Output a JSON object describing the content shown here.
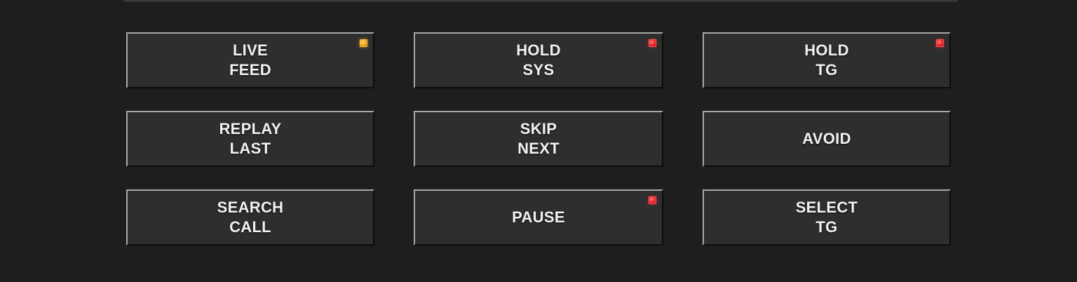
{
  "buttons": [
    {
      "id": "live-feed",
      "lines": [
        "LIVE",
        "FEED"
      ],
      "indicator": "amber"
    },
    {
      "id": "hold-sys",
      "lines": [
        "HOLD",
        "SYS"
      ],
      "indicator": "red"
    },
    {
      "id": "hold-tg",
      "lines": [
        "HOLD",
        "TG"
      ],
      "indicator": "red"
    },
    {
      "id": "replay-last",
      "lines": [
        "REPLAY",
        "LAST"
      ],
      "indicator": null
    },
    {
      "id": "skip-next",
      "lines": [
        "SKIP",
        "NEXT"
      ],
      "indicator": null
    },
    {
      "id": "avoid",
      "lines": [
        "AVOID"
      ],
      "indicator": null
    },
    {
      "id": "search-call",
      "lines": [
        "SEARCH",
        "CALL"
      ],
      "indicator": null
    },
    {
      "id": "pause",
      "lines": [
        "PAUSE"
      ],
      "indicator": "red"
    },
    {
      "id": "select-tg",
      "lines": [
        "SELECT",
        "TG"
      ],
      "indicator": null
    }
  ],
  "colors": {
    "background": "#1e1e1e",
    "button_face": "#2e2e2e",
    "text": "#f2f2f2",
    "indicator_red": "#e8232a",
    "indicator_amber": "#f2a51c"
  }
}
